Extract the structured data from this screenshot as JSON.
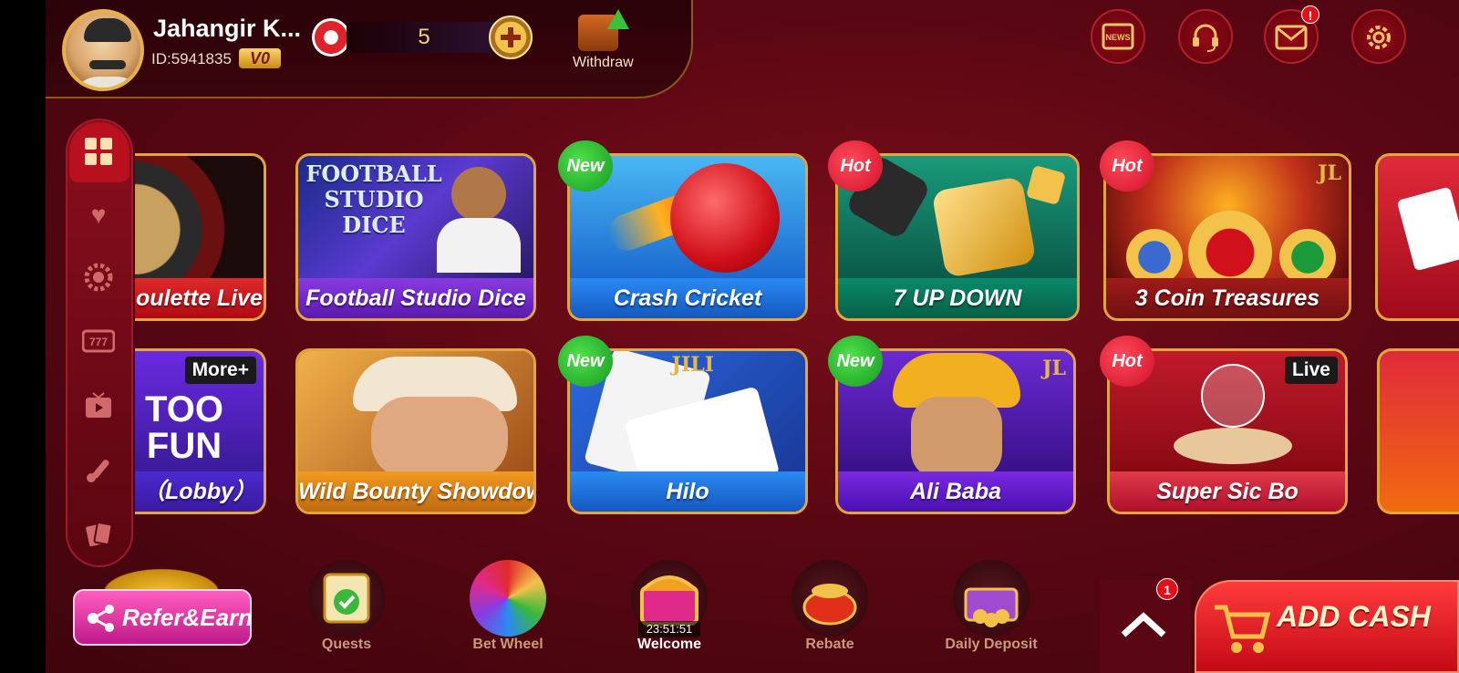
{
  "user": {
    "name": "Jahangir K...",
    "id": "ID:5941835",
    "vip": "V0"
  },
  "wallet": {
    "balance": "5",
    "withdraw_label": "Withdraw"
  },
  "top_icons": [
    "news-icon",
    "support-headset-icon",
    "mail-icon",
    "settings-gear-icon"
  ],
  "top_icon_news_text": "NEWS",
  "mail_badge": "!",
  "sidebar": [
    "grid-icon",
    "heart-icon",
    "casino-chip-icon",
    "slot-777-icon",
    "tv-icon",
    "cricket-icon",
    "cards-icon"
  ],
  "games_row1": [
    {
      "label": "oulette Live",
      "tag": ""
    },
    {
      "label": "Football Studio Dice",
      "tag": "",
      "art_text": "FOOTBALL STUDIO DICE"
    },
    {
      "label": "Crash Cricket",
      "tag": "New"
    },
    {
      "label": "7 UP DOWN",
      "tag": "Hot"
    },
    {
      "label": "3 Coin Treasures",
      "tag": "Hot",
      "corner": "JL"
    }
  ],
  "games_row2": [
    {
      "label": "（Lobby）",
      "tag": "",
      "corner": "More+",
      "art_text": "TOO FUN"
    },
    {
      "label": "Wild Bounty Showdown",
      "tag": ""
    },
    {
      "label": "Hilo",
      "tag": "New",
      "corner": "JILI"
    },
    {
      "label": "Ali Baba",
      "tag": "New",
      "corner": "JL"
    },
    {
      "label": "Super Sic Bo",
      "tag": "Hot",
      "corner": "Live"
    }
  ],
  "refer_label": "Refer&Earn",
  "bottom_nav": [
    {
      "label": "Quests"
    },
    {
      "label": "Bet Wheel"
    },
    {
      "label": "Welcome",
      "timer": "23:51:51"
    },
    {
      "label": "Rebate"
    },
    {
      "label": "Daily Deposit"
    }
  ],
  "scroll_up_badge": "1",
  "add_cash_label": "ADD CASH",
  "colors": {
    "background": "#5a0713",
    "gold": "#e3a63a",
    "add_cash": "#e0141f",
    "refer": "#e03aa8"
  }
}
